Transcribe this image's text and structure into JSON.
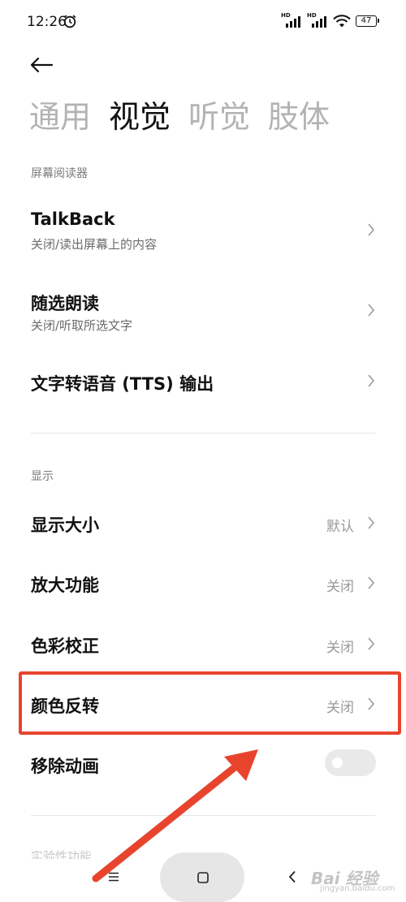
{
  "status": {
    "time": "12:26",
    "hd": "HD",
    "battery": "47"
  },
  "tabs": [
    {
      "label": "通用",
      "active": false
    },
    {
      "label": "视觉",
      "active": true
    },
    {
      "label": "听觉",
      "active": false
    },
    {
      "label": "肢体",
      "active": false
    }
  ],
  "sections": {
    "screen_reader": "屏幕阅读器",
    "display": "显示",
    "experimental_partial": "实验性功能"
  },
  "rows": {
    "talkback": {
      "title": "TalkBack",
      "subtitle": "关闭/读出屏幕上的内容"
    },
    "select_to_speak": {
      "title": "随选朗读",
      "subtitle": "关闭/听取所选文字"
    },
    "tts": {
      "title": "文字转语音 (TTS) 输出"
    },
    "display_size": {
      "title": "显示大小",
      "value": "默认"
    },
    "magnification": {
      "title": "放大功能",
      "value": "关闭"
    },
    "color_correction": {
      "title": "色彩校正",
      "value": "关闭"
    },
    "color_inversion": {
      "title": "颜色反转",
      "value": "关闭"
    },
    "remove_animations": {
      "title": "移除动画",
      "toggle_on": false
    }
  },
  "watermark": {
    "text": "Bai 经验",
    "sub": "jingyan.baidu.com"
  },
  "colors": {
    "highlight": "#e8442d",
    "active_tab": "#111111",
    "inactive_tab": "#b3b3b3"
  },
  "icons": [
    "alarm-icon",
    "signal-icon",
    "wifi-icon",
    "battery-icon",
    "back-arrow-icon",
    "chevron-right-icon",
    "menu-icon",
    "home-icon",
    "back-nav-icon"
  ]
}
